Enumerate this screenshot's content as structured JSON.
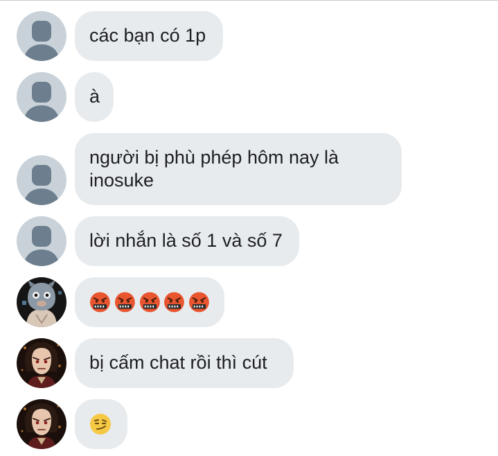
{
  "messages": [
    {
      "text": "các bạn có 1p"
    },
    {
      "text": "à"
    },
    {
      "text": "người bị phù phép hôm nay là inosuke"
    },
    {
      "text": "lời nhắn là số 1 và số 7"
    },
    {
      "emojis": [
        "enraged-face-with-symbols-icon",
        "enraged-face-with-symbols-icon",
        "enraged-face-with-symbols-icon",
        "enraged-face-with-symbols-icon",
        "enraged-face-with-symbols-icon"
      ]
    },
    {
      "text": "bị cấm chat rồi thì cút"
    },
    {
      "emojis": [
        "smirking-face-icon"
      ]
    }
  ],
  "colors": {
    "bubble_bg": "#e8ebee",
    "text": "#1c1e21",
    "default_avatar_bg": "#c9d2d9",
    "default_avatar_fg": "#6d7f8e"
  }
}
